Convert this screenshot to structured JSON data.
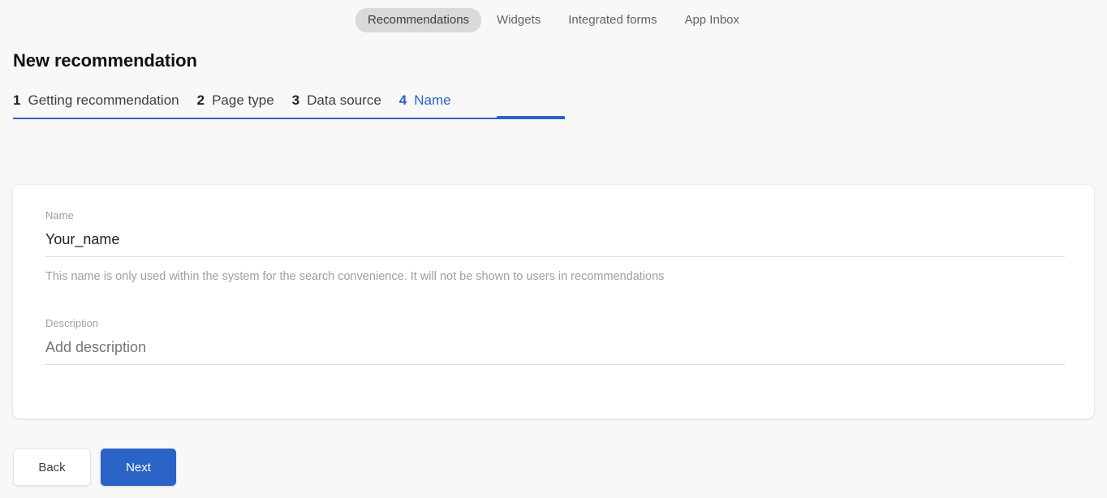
{
  "top_nav": {
    "items": [
      {
        "label": "Recommendations",
        "active": true
      },
      {
        "label": "Widgets",
        "active": false
      },
      {
        "label": "Integrated forms",
        "active": false
      },
      {
        "label": "App Inbox",
        "active": false
      }
    ]
  },
  "page": {
    "title": "New recommendation"
  },
  "steps": [
    {
      "num": "1",
      "label": "Getting recommendation",
      "active": false
    },
    {
      "num": "2",
      "label": "Page type",
      "active": false
    },
    {
      "num": "3",
      "label": "Data source",
      "active": false
    },
    {
      "num": "4",
      "label": "Name",
      "active": true
    }
  ],
  "form": {
    "name_field": {
      "label": "Name",
      "value": "Your_name",
      "placeholder": "Your_name",
      "help": "This name is only used within the system for the search convenience. It will not be shown to users in recommendations"
    },
    "description_field": {
      "label": "Description",
      "value": "",
      "placeholder": "Add description"
    }
  },
  "footer": {
    "back_label": "Back",
    "next_label": "Next"
  },
  "colors": {
    "accent_blue": "#2b63c7",
    "pill_gray": "#d9d9d9",
    "page_bg": "#f8f8f8",
    "card_bg": "#ffffff",
    "muted_text": "#9aa0a6"
  }
}
